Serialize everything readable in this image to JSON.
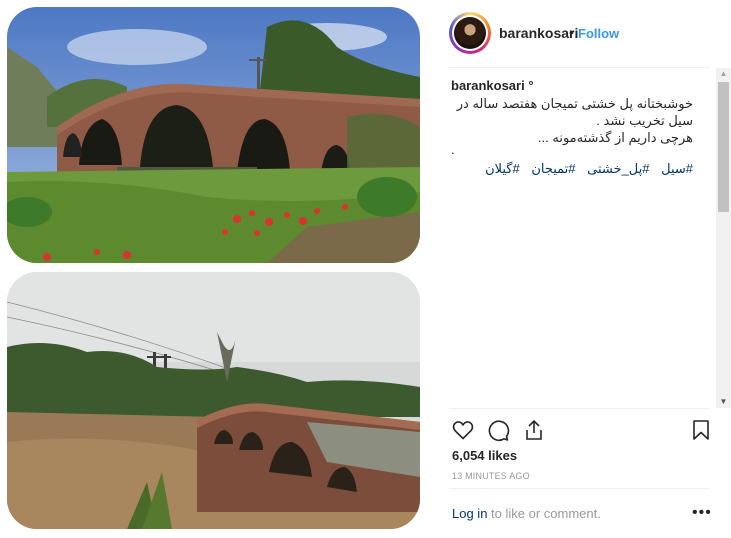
{
  "post": {
    "username": "barankosari",
    "follow_label": "Follow",
    "separator": "•"
  },
  "caption": {
    "username": "barankosari",
    "suffix": "°",
    "lines": [
      "خوشبختانه پل خشتی تمیجان هفتصد ساله در",
      "سیل تخریب نشد .",
      "هرچی داریم از گذشته‌مونه ..."
    ],
    "line4": ".",
    "hashtags": [
      "#گیلان",
      "#تمیجان",
      "#پل_خشتی",
      "#سیل"
    ]
  },
  "engagement": {
    "likes": "6,054 likes",
    "timestamp": "13 MINUTES AGO"
  },
  "comment_bar": {
    "login_label": "Log in",
    "rest_label": " to like or comment.",
    "more_label": "•••"
  },
  "icons": {
    "like": "heart-icon",
    "comment": "comment-icon",
    "share": "share-icon",
    "save": "bookmark-icon",
    "scroll_up": "arrow-up-icon",
    "scroll_down": "arrow-down-icon"
  },
  "colors": {
    "link_blue": "#3897f0",
    "hashtag_blue": "#003569",
    "muted": "#999999"
  }
}
